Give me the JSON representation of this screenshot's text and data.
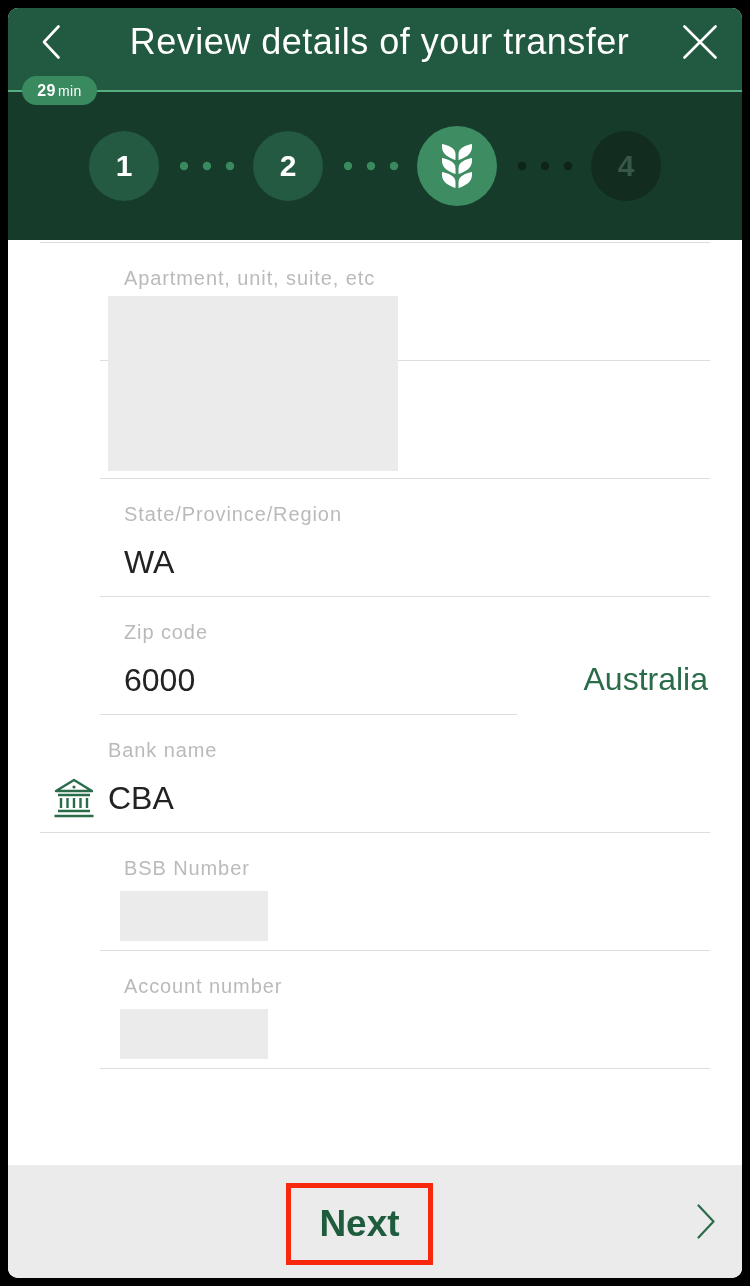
{
  "header": {
    "title": "Review details of your transfer",
    "timer": "**29**min"
  },
  "stepper": {
    "steps": [
      {
        "kind": "number",
        "label": "1",
        "selected": false
      },
      {
        "kind": "number",
        "label": "2",
        "selected": false
      },
      {
        "kind": "icon",
        "selected": true
      },
      {
        "kind": "number",
        "label": "4",
        "selected": false
      }
    ]
  },
  "fields": [
    {
      "kind": "redacted_tall",
      "label": "Apartment, unit, suite, etc"
    },
    {
      "kind": "text",
      "label": "State/Province/Region",
      "value": "WA"
    },
    {
      "kind": "zip",
      "label": "Zip code",
      "value": "6000",
      "country": "Australia"
    },
    {
      "kind": "bank",
      "label": "Bank name",
      "value": "CBA"
    },
    {
      "kind": "redacted",
      "label": "BSB Number"
    },
    {
      "kind": "redacted",
      "label": "Account number"
    }
  ],
  "footer": {
    "next_button": {
      "label": "Next",
      "highlighted": true
    }
  }
}
